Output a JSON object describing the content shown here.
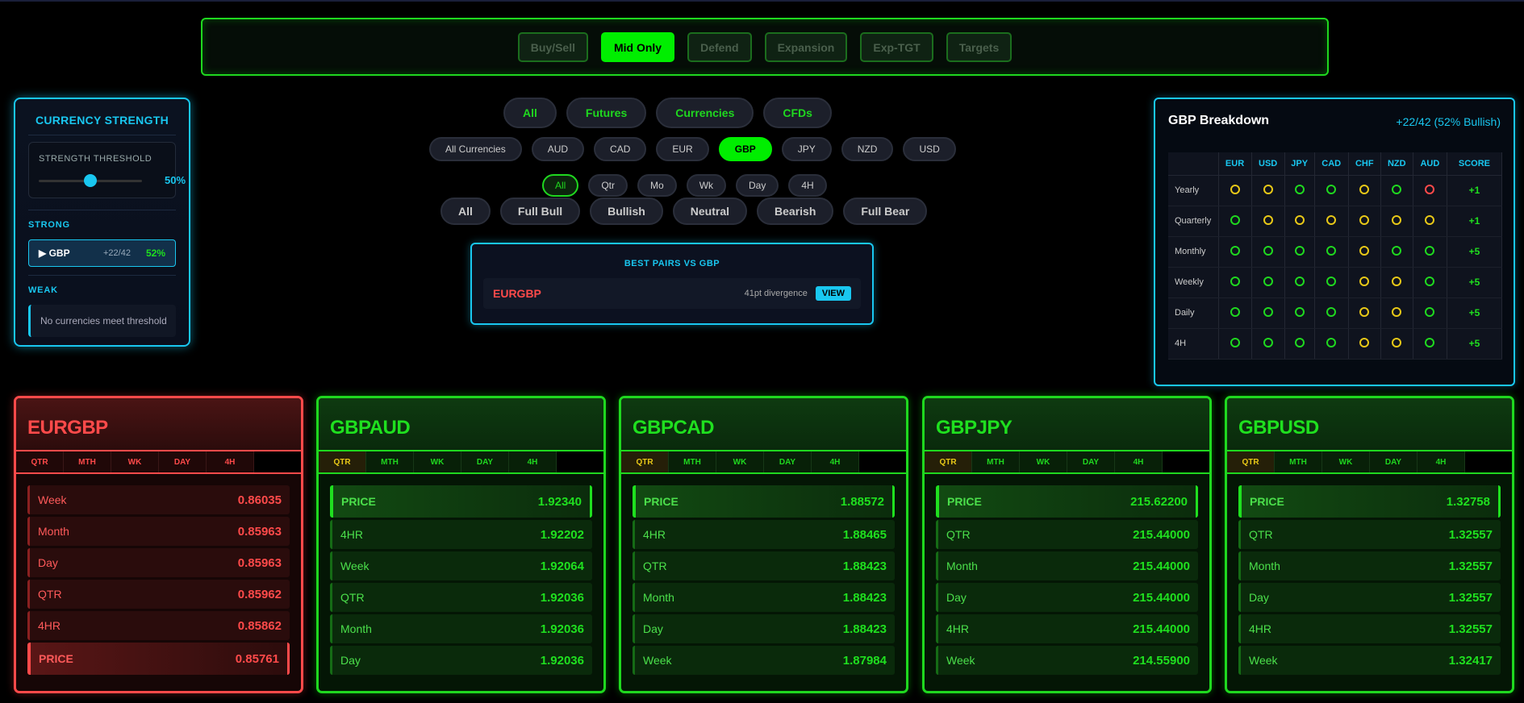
{
  "modes": [
    {
      "label": "Buy/Sell",
      "active": false
    },
    {
      "label": "Mid Only",
      "active": true
    },
    {
      "label": "Defend",
      "active": false
    },
    {
      "label": "Expansion",
      "active": false
    },
    {
      "label": "Exp-TGT",
      "active": false
    },
    {
      "label": "Targets",
      "active": false
    }
  ],
  "strength": {
    "title": "CURRENCY STRENGTH",
    "threshold_label": "STRENGTH THRESHOLD",
    "threshold_value": "50%",
    "threshold_level": 0.5,
    "strong_label": "STRONG",
    "strong_item": {
      "name": "▶ GBP",
      "score": "+22/42",
      "pct": "52%"
    },
    "weak_label": "WEAK",
    "weak_text": "No currencies meet threshold"
  },
  "categories": [
    {
      "label": "All",
      "active": false
    },
    {
      "label": "Futures",
      "active": false
    },
    {
      "label": "Currencies",
      "active": false
    },
    {
      "label": "CFDs",
      "active": false
    }
  ],
  "currencies": [
    {
      "label": "All Currencies",
      "active": false
    },
    {
      "label": "AUD",
      "active": false
    },
    {
      "label": "CAD",
      "active": false
    },
    {
      "label": "EUR",
      "active": false
    },
    {
      "label": "GBP",
      "active": true
    },
    {
      "label": "JPY",
      "active": false
    },
    {
      "label": "NZD",
      "active": false
    },
    {
      "label": "USD",
      "active": false
    }
  ],
  "timeframes": [
    {
      "label": "All",
      "active": true
    },
    {
      "label": "Qtr",
      "active": false
    },
    {
      "label": "Mo",
      "active": false
    },
    {
      "label": "Wk",
      "active": false
    },
    {
      "label": "Day",
      "active": false
    },
    {
      "label": "4H",
      "active": false
    }
  ],
  "sentiments": [
    "All",
    "Full Bull",
    "Bullish",
    "Neutral",
    "Bearish",
    "Full Bear"
  ],
  "best": {
    "title": "BEST PAIRS VS GBP",
    "pair": "EURGBP",
    "divergence": "41pt divergence",
    "view": "VIEW"
  },
  "breakdown": {
    "title": "GBP Breakdown",
    "summary": "+22/42 (52% Bullish)",
    "columns": [
      "EUR",
      "USD",
      "JPY",
      "CAD",
      "CHF",
      "NZD",
      "AUD",
      "SCORE"
    ],
    "rows": [
      {
        "label": "Yearly",
        "cells": [
          "y",
          "y",
          "g",
          "g",
          "y",
          "g",
          "r"
        ],
        "score": "+1"
      },
      {
        "label": "Quarterly",
        "cells": [
          "g",
          "y",
          "y",
          "y",
          "y",
          "y",
          "y"
        ],
        "score": "+1"
      },
      {
        "label": "Monthly",
        "cells": [
          "g",
          "g",
          "g",
          "g",
          "y",
          "g",
          "g"
        ],
        "score": "+5"
      },
      {
        "label": "Weekly",
        "cells": [
          "g",
          "g",
          "g",
          "g",
          "y",
          "y",
          "g"
        ],
        "score": "+5"
      },
      {
        "label": "Daily",
        "cells": [
          "g",
          "g",
          "g",
          "g",
          "y",
          "y",
          "g"
        ],
        "score": "+5"
      },
      {
        "label": "4H",
        "cells": [
          "g",
          "g",
          "g",
          "g",
          "y",
          "y",
          "g"
        ],
        "score": "+5"
      }
    ]
  },
  "cards": [
    {
      "pair": "EURGBP",
      "color": "red",
      "tabs": [
        "QTR",
        "MTH",
        "WK",
        "DAY",
        "4H"
      ],
      "selected_tab": -1,
      "rows": [
        {
          "l": "Week",
          "v": "0.86035"
        },
        {
          "l": "Month",
          "v": "0.85963"
        },
        {
          "l": "Day",
          "v": "0.85963"
        },
        {
          "l": "QTR",
          "v": "0.85962"
        },
        {
          "l": "4HR",
          "v": "0.85862"
        },
        {
          "l": "PRICE",
          "v": "0.85761",
          "price": true
        }
      ]
    },
    {
      "pair": "GBPAUD",
      "color": "green",
      "tabs": [
        "QTR",
        "MTH",
        "WK",
        "DAY",
        "4H"
      ],
      "selected_tab": 0,
      "rows": [
        {
          "l": "PRICE",
          "v": "1.92340",
          "price": true
        },
        {
          "l": "4HR",
          "v": "1.92202"
        },
        {
          "l": "Week",
          "v": "1.92064"
        },
        {
          "l": "QTR",
          "v": "1.92036"
        },
        {
          "l": "Month",
          "v": "1.92036"
        },
        {
          "l": "Day",
          "v": "1.92036"
        }
      ]
    },
    {
      "pair": "GBPCAD",
      "color": "green",
      "tabs": [
        "QTR",
        "MTH",
        "WK",
        "DAY",
        "4H"
      ],
      "selected_tab": 0,
      "rows": [
        {
          "l": "PRICE",
          "v": "1.88572",
          "price": true
        },
        {
          "l": "4HR",
          "v": "1.88465"
        },
        {
          "l": "QTR",
          "v": "1.88423"
        },
        {
          "l": "Month",
          "v": "1.88423"
        },
        {
          "l": "Day",
          "v": "1.88423"
        },
        {
          "l": "Week",
          "v": "1.87984"
        }
      ]
    },
    {
      "pair": "GBPJPY",
      "color": "green",
      "tabs": [
        "QTR",
        "MTH",
        "WK",
        "DAY",
        "4H"
      ],
      "selected_tab": 0,
      "rows": [
        {
          "l": "PRICE",
          "v": "215.62200",
          "price": true
        },
        {
          "l": "QTR",
          "v": "215.44000"
        },
        {
          "l": "Month",
          "v": "215.44000"
        },
        {
          "l": "Day",
          "v": "215.44000"
        },
        {
          "l": "4HR",
          "v": "215.44000"
        },
        {
          "l": "Week",
          "v": "214.55900"
        }
      ]
    },
    {
      "pair": "GBPUSD",
      "color": "green",
      "tabs": [
        "QTR",
        "MTH",
        "WK",
        "DAY",
        "4H"
      ],
      "selected_tab": 0,
      "rows": [
        {
          "l": "PRICE",
          "v": "1.32758",
          "price": true
        },
        {
          "l": "QTR",
          "v": "1.32557"
        },
        {
          "l": "Month",
          "v": "1.32557"
        },
        {
          "l": "Day",
          "v": "1.32557"
        },
        {
          "l": "4HR",
          "v": "1.32557"
        },
        {
          "l": "Week",
          "v": "1.32417"
        }
      ]
    }
  ]
}
